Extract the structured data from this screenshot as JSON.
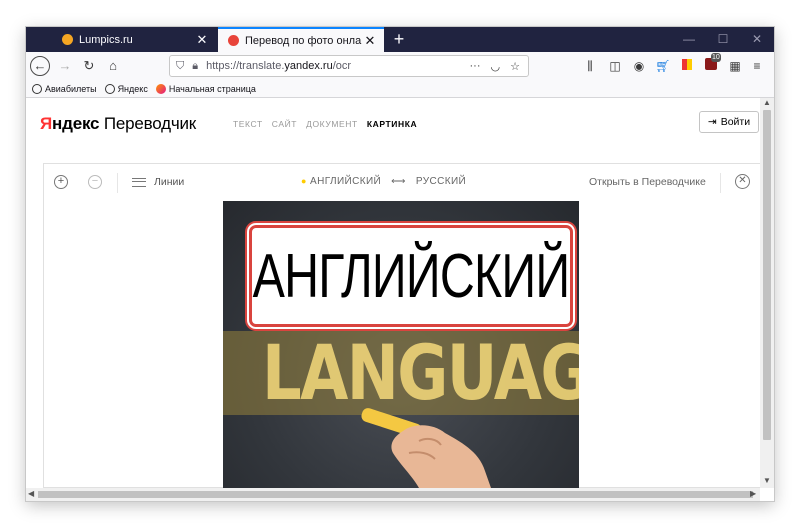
{
  "browser": {
    "tabs": [
      {
        "label": "Lumpics.ru",
        "close": "✕",
        "active": false
      },
      {
        "label": "Перевод по фото онлайн с ан",
        "close": "✕",
        "active": true
      }
    ],
    "new_tab": "+",
    "window_controls": {
      "minimize": "—",
      "maximize": "☐",
      "close": "✕"
    },
    "url_prefix": "https://translate.",
    "url_host": "yandex.ru",
    "url_path": "/ocr",
    "url_more": "···",
    "bookmarks": [
      "Авиабилеты",
      "Яндекс",
      "Начальная страница"
    ],
    "badge_count": "10",
    "accent": "#0a84ff"
  },
  "page": {
    "brand_ya": "Я",
    "brand_ndeks": "ндекс",
    "brand_product": " Переводчик",
    "nav": [
      "ТЕКСТ",
      "САЙТ",
      "ДОКУМЕНТ",
      "КАРТИНКА"
    ],
    "login_label": "Войти",
    "toolbar": {
      "zoom_in": "+",
      "zoom_out": "−",
      "lines_label": "Линии",
      "source_lang": "АНГЛИЙСКИЙ",
      "swap": "⟷",
      "target_lang": "РУССКИЙ",
      "open_in_translator": "Открыть в Переводчике",
      "close": "✕"
    },
    "image": {
      "recognized_text": "АНГЛИЙСКИЙ",
      "chalk_text": "LANGUAGE"
    },
    "colors": {
      "brand_red": "#ff3333",
      "highlight": "#d9443e",
      "lang_dot": "#ffcc00"
    }
  }
}
